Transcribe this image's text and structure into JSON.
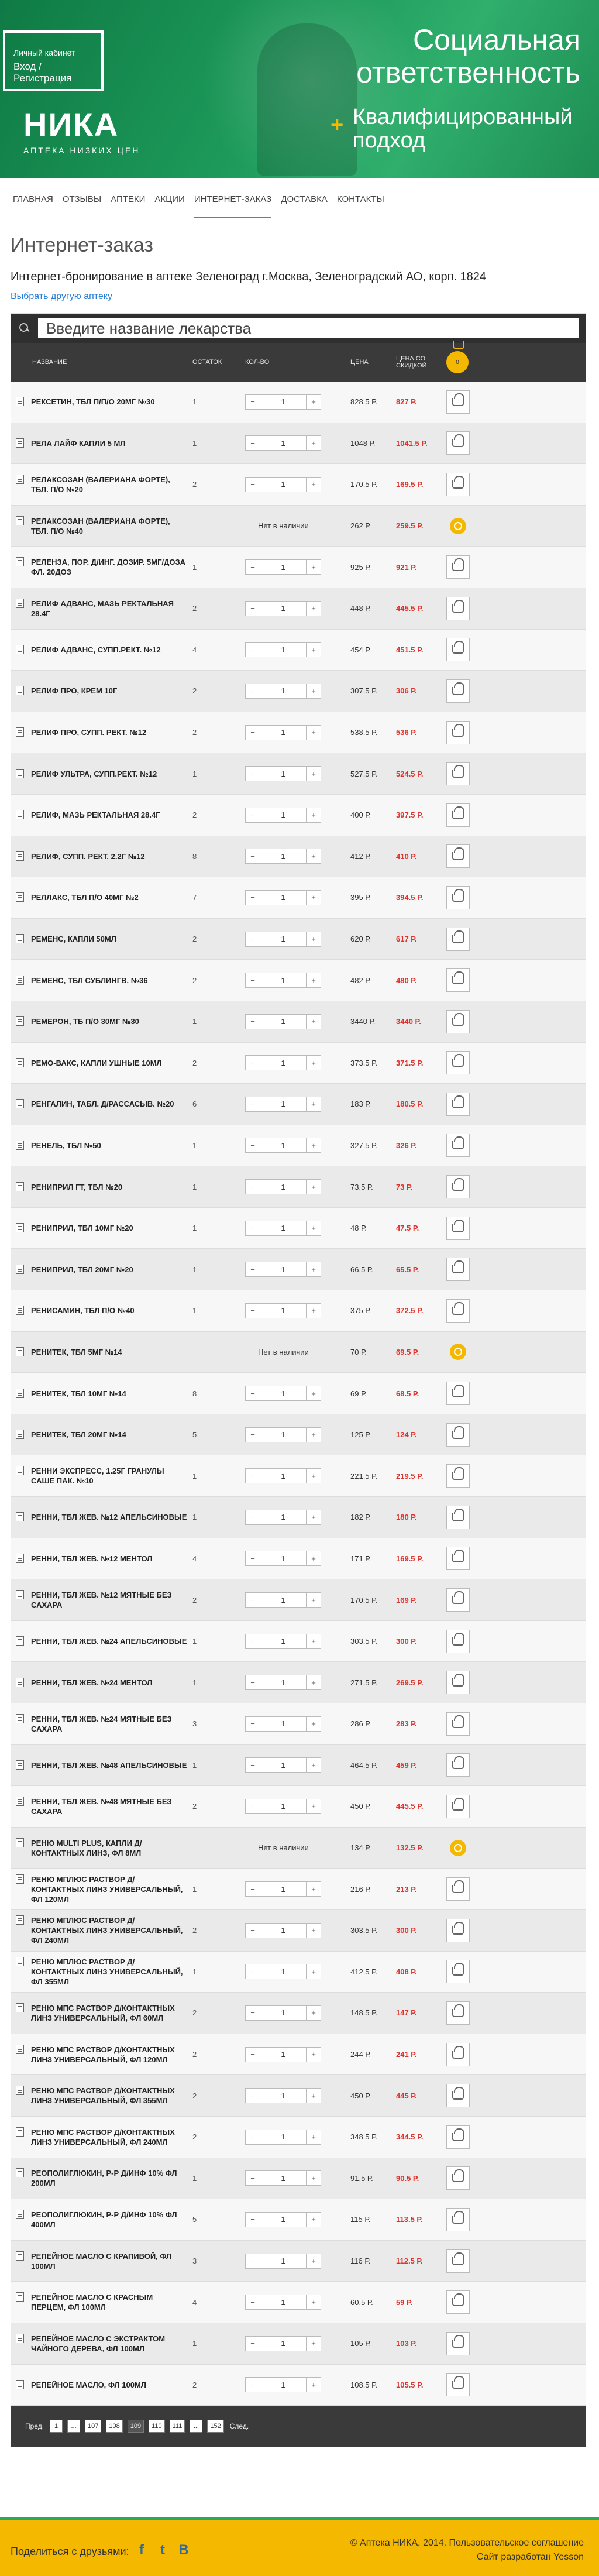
{
  "hero": {
    "lk_title": "Личный кабинет",
    "lk_link": "Вход / Регистрация",
    "logo_word": "НИКА",
    "logo_sub": "АПТЕКА НИЗКИХ ЦЕН",
    "headline_line1": "Социальная",
    "headline_line2": "ответственность",
    "sub_line1": "Квалифицированный",
    "sub_line2": "подход",
    "plus": "+"
  },
  "nav": {
    "items": [
      "ГЛАВНАЯ",
      "ОТЗЫВЫ",
      "АПТЕКИ",
      "АКЦИИ",
      "ИНТЕРНЕТ-ЗАКАЗ",
      "ДОСТАВКА",
      "КОНТАКТЫ"
    ],
    "active_index": 4
  },
  "page": {
    "title": "Интернет-заказ",
    "booking": "Интернет-бронирование в аптеке Зеленоград г.Москва, Зеленоградский АО, корп. 1824",
    "other_pharmacy": "Выбрать другую аптеку"
  },
  "search": {
    "placeholder": "Введите название лекарства"
  },
  "table_head": {
    "name": "НАЗВАНИЕ",
    "stock": "ОСТАТОК",
    "qty": "КОЛ-ВО",
    "price": "ЦЕНА",
    "discount": "ЦЕНА СО СКИДКОЙ",
    "cart_count": "0"
  },
  "qty_minus": "−",
  "qty_plus": "+",
  "not_available": "Нет в наличии",
  "rows": [
    {
      "name": "РЕКСЕТИН, ТБЛ П/П/О 20МГ №30",
      "stock": "1",
      "qty": "1",
      "price": "828.5 Р.",
      "disc": "827 Р.",
      "available": true
    },
    {
      "name": "РЕЛА ЛАЙФ КАПЛИ 5 МЛ",
      "stock": "1",
      "qty": "1",
      "price": "1048 Р.",
      "disc": "1041.5 Р.",
      "available": true
    },
    {
      "name": "РЕЛАКСОЗАН (ВАЛЕРИАНА ФОРТЕ), ТБЛ. П/О №20",
      "stock": "2",
      "qty": "1",
      "price": "170.5 Р.",
      "disc": "169.5 Р.",
      "available": true
    },
    {
      "name": "РЕЛАКСОЗАН (ВАЛЕРИАНА ФОРТЕ), ТБЛ. П/О №40",
      "stock": "",
      "qty": "",
      "price": "262 Р.",
      "disc": "259.5 Р.",
      "available": false
    },
    {
      "name": "РЕЛЕНЗА, ПОР. Д/ИНГ. ДОЗИР. 5МГ/ДОЗА ФЛ. 20ДОЗ",
      "stock": "1",
      "qty": "1",
      "price": "925 Р.",
      "disc": "921 Р.",
      "available": true
    },
    {
      "name": "РЕЛИФ АДВАНС, МАЗЬ РЕКТАЛЬНАЯ 28.4Г",
      "stock": "2",
      "qty": "1",
      "price": "448 Р.",
      "disc": "445.5 Р.",
      "available": true
    },
    {
      "name": "РЕЛИФ АДВАНС, СУПП.РЕКТ. №12",
      "stock": "4",
      "qty": "1",
      "price": "454 Р.",
      "disc": "451.5 Р.",
      "available": true
    },
    {
      "name": "РЕЛИФ ПРО, КРЕМ 10Г",
      "stock": "2",
      "qty": "1",
      "price": "307.5 Р.",
      "disc": "306 Р.",
      "available": true
    },
    {
      "name": "РЕЛИФ ПРО, СУПП. РЕКТ. №12",
      "stock": "2",
      "qty": "1",
      "price": "538.5 Р.",
      "disc": "536 Р.",
      "available": true
    },
    {
      "name": "РЕЛИФ УЛЬТРА, СУПП.РЕКТ. №12",
      "stock": "1",
      "qty": "1",
      "price": "527.5 Р.",
      "disc": "524.5 Р.",
      "available": true
    },
    {
      "name": "РЕЛИФ, МАЗЬ РЕКТАЛЬНАЯ 28.4Г",
      "stock": "2",
      "qty": "1",
      "price": "400 Р.",
      "disc": "397.5 Р.",
      "available": true
    },
    {
      "name": "РЕЛИФ, СУПП. РЕКТ. 2.2Г №12",
      "stock": "8",
      "qty": "1",
      "price": "412 Р.",
      "disc": "410 Р.",
      "available": true
    },
    {
      "name": "РЕЛЛАКС, ТБЛ П/О 40МГ №2",
      "stock": "7",
      "qty": "1",
      "price": "395 Р.",
      "disc": "394.5 Р.",
      "available": true
    },
    {
      "name": "РЕМЕНС, КАПЛИ 50МЛ",
      "stock": "2",
      "qty": "1",
      "price": "620 Р.",
      "disc": "617 Р.",
      "available": true
    },
    {
      "name": "РЕМЕНС, ТБЛ СУБЛИНГВ. №36",
      "stock": "2",
      "qty": "1",
      "price": "482 Р.",
      "disc": "480 Р.",
      "available": true
    },
    {
      "name": "РЕМЕРОН, ТБ П/О 30МГ №30",
      "stock": "1",
      "qty": "1",
      "price": "3440 Р.",
      "disc": "3440 Р.",
      "available": true
    },
    {
      "name": "РЕМО-ВАКС, КАПЛИ УШНЫЕ 10МЛ",
      "stock": "2",
      "qty": "1",
      "price": "373.5 Р.",
      "disc": "371.5 Р.",
      "available": true
    },
    {
      "name": "РЕНГАЛИН, ТАБЛ. Д/РАССАСЫВ. №20",
      "stock": "6",
      "qty": "1",
      "price": "183 Р.",
      "disc": "180.5 Р.",
      "available": true
    },
    {
      "name": "РЕНЕЛЬ, ТБЛ №50",
      "stock": "1",
      "qty": "1",
      "price": "327.5 Р.",
      "disc": "326 Р.",
      "available": true
    },
    {
      "name": "РЕНИПРИЛ ГТ, ТБЛ №20",
      "stock": "1",
      "qty": "1",
      "price": "73.5 Р.",
      "disc": "73 Р.",
      "available": true
    },
    {
      "name": "РЕНИПРИЛ, ТБЛ 10МГ №20",
      "stock": "1",
      "qty": "1",
      "price": "48 Р.",
      "disc": "47.5 Р.",
      "available": true
    },
    {
      "name": "РЕНИПРИЛ, ТБЛ 20МГ №20",
      "stock": "1",
      "qty": "1",
      "price": "66.5 Р.",
      "disc": "65.5 Р.",
      "available": true
    },
    {
      "name": "РЕНИСАМИН, ТБЛ П/О №40",
      "stock": "1",
      "qty": "1",
      "price": "375 Р.",
      "disc": "372.5 Р.",
      "available": true
    },
    {
      "name": "РЕНИТЕК, ТБЛ 5МГ №14",
      "stock": "",
      "qty": "",
      "price": "70 Р.",
      "disc": "69.5 Р.",
      "available": false
    },
    {
      "name": "РЕНИТЕК, ТБЛ 10МГ №14",
      "stock": "8",
      "qty": "1",
      "price": "69 Р.",
      "disc": "68.5 Р.",
      "available": true
    },
    {
      "name": "РЕНИТЕК, ТБЛ 20МГ №14",
      "stock": "5",
      "qty": "1",
      "price": "125 Р.",
      "disc": "124 Р.",
      "available": true
    },
    {
      "name": "РЕННИ ЭКСПРЕСС, 1.25Г ГРАНУЛЫ САШЕ ПАК. №10",
      "stock": "1",
      "qty": "1",
      "price": "221.5 Р.",
      "disc": "219.5 Р.",
      "available": true
    },
    {
      "name": "РЕННИ, ТБЛ ЖЕВ. №12 АПЕЛЬСИНОВЫЕ",
      "stock": "1",
      "qty": "1",
      "price": "182 Р.",
      "disc": "180 Р.",
      "available": true
    },
    {
      "name": "РЕННИ, ТБЛ ЖЕВ. №12 МЕНТОЛ",
      "stock": "4",
      "qty": "1",
      "price": "171 Р.",
      "disc": "169.5 Р.",
      "available": true
    },
    {
      "name": "РЕННИ, ТБЛ ЖЕВ. №12 МЯТНЫЕ БЕЗ САХАРА",
      "stock": "2",
      "qty": "1",
      "price": "170.5 Р.",
      "disc": "169 Р.",
      "available": true
    },
    {
      "name": "РЕННИ, ТБЛ ЖЕВ. №24 АПЕЛЬСИНОВЫЕ",
      "stock": "1",
      "qty": "1",
      "price": "303.5 Р.",
      "disc": "300 Р.",
      "available": true
    },
    {
      "name": "РЕННИ, ТБЛ ЖЕВ. №24 МЕНТОЛ",
      "stock": "1",
      "qty": "1",
      "price": "271.5 Р.",
      "disc": "269.5 Р.",
      "available": true
    },
    {
      "name": "РЕННИ, ТБЛ ЖЕВ. №24 МЯТНЫЕ БЕЗ САХАРА",
      "stock": "3",
      "qty": "1",
      "price": "286 Р.",
      "disc": "283 Р.",
      "available": true
    },
    {
      "name": "РЕННИ, ТБЛ ЖЕВ. №48 АПЕЛЬСИНОВЫЕ",
      "stock": "1",
      "qty": "1",
      "price": "464.5 Р.",
      "disc": "459 Р.",
      "available": true
    },
    {
      "name": "РЕННИ, ТБЛ ЖЕВ. №48 МЯТНЫЕ БЕЗ САХАРА",
      "stock": "2",
      "qty": "1",
      "price": "450 Р.",
      "disc": "445.5 Р.",
      "available": true
    },
    {
      "name": "РЕНЮ MULTI PLUS, КАПЛИ Д/КОНТАКТНЫХ ЛИНЗ, ФЛ 8МЛ",
      "stock": "",
      "qty": "",
      "price": "134 Р.",
      "disc": "132.5 Р.",
      "available": false
    },
    {
      "name": "РЕНЮ МПЛЮС РАСТВОР Д/КОНТАКТНЫХ ЛИНЗ УНИВЕРСАЛЬНЫЙ, ФЛ 120МЛ",
      "stock": "1",
      "qty": "1",
      "price": "216 Р.",
      "disc": "213 Р.",
      "available": true
    },
    {
      "name": "РЕНЮ МПЛЮС РАСТВОР Д/КОНТАКТНЫХ ЛИНЗ УНИВЕРСАЛЬНЫЙ, ФЛ 240МЛ",
      "stock": "2",
      "qty": "1",
      "price": "303.5 Р.",
      "disc": "300 Р.",
      "available": true
    },
    {
      "name": "РЕНЮ МПЛЮС РАСТВОР Д/КОНТАКТНЫХ ЛИНЗ УНИВЕРСАЛЬНЫЙ, ФЛ 355МЛ",
      "stock": "1",
      "qty": "1",
      "price": "412.5 Р.",
      "disc": "408 Р.",
      "available": true
    },
    {
      "name": "РЕНЮ МПС РАСТВОР Д/КОНТАКТНЫХ ЛИНЗ УНИВЕРСАЛЬНЫЙ, ФЛ 60МЛ",
      "stock": "2",
      "qty": "1",
      "price": "148.5 Р.",
      "disc": "147 Р.",
      "available": true
    },
    {
      "name": "РЕНЮ МПС РАСТВОР Д/КОНТАКТНЫХ ЛИНЗ УНИВЕРСАЛЬНЫЙ, ФЛ 120МЛ",
      "stock": "2",
      "qty": "1",
      "price": "244 Р.",
      "disc": "241 Р.",
      "available": true
    },
    {
      "name": "РЕНЮ МПС РАСТВОР Д/КОНТАКТНЫХ ЛИНЗ УНИВЕРСАЛЬНЫЙ, ФЛ 355МЛ",
      "stock": "2",
      "qty": "1",
      "price": "450 Р.",
      "disc": "445 Р.",
      "available": true
    },
    {
      "name": "РЕНЮ МПС РАСТВОР Д/КОНТАКТНЫХ ЛИНЗ УНИВЕРСАЛЬНЫЙ, ФЛ 240МЛ",
      "stock": "2",
      "qty": "1",
      "price": "348.5 Р.",
      "disc": "344.5 Р.",
      "available": true
    },
    {
      "name": "РЕОПОЛИГЛЮКИН, Р-Р Д/ИНФ 10% ФЛ 200МЛ",
      "stock": "1",
      "qty": "1",
      "price": "91.5 Р.",
      "disc": "90.5 Р.",
      "available": true
    },
    {
      "name": "РЕОПОЛИГЛЮКИН, Р-Р Д/ИНФ 10% ФЛ 400МЛ",
      "stock": "5",
      "qty": "1",
      "price": "115 Р.",
      "disc": "113.5 Р.",
      "available": true
    },
    {
      "name": "РЕПЕЙНОЕ МАСЛО С КРАПИВОЙ, ФЛ 100МЛ",
      "stock": "3",
      "qty": "1",
      "price": "116 Р.",
      "disc": "112.5 Р.",
      "available": true
    },
    {
      "name": "РЕПЕЙНОЕ МАСЛО С КРАСНЫМ ПЕРЦЕМ, ФЛ 100МЛ",
      "stock": "4",
      "qty": "1",
      "price": "60.5 Р.",
      "disc": "59 Р.",
      "available": true
    },
    {
      "name": "РЕПЕЙНОЕ МАСЛО С ЭКСТРАКТОМ ЧАЙНОГО ДЕРЕВА, ФЛ 100МЛ",
      "stock": "1",
      "qty": "1",
      "price": "105 Р.",
      "disc": "103 Р.",
      "available": true
    },
    {
      "name": "РЕПЕЙНОЕ МАСЛО, ФЛ 100МЛ",
      "stock": "2",
      "qty": "1",
      "price": "108.5 Р.",
      "disc": "105.5 Р.",
      "available": true
    }
  ],
  "pager": {
    "prev": "Пред.",
    "next": "След.",
    "pages": [
      "1",
      "...",
      "107",
      "108",
      "109",
      "110",
      "111",
      "...",
      "152"
    ],
    "current": "109"
  },
  "footer": {
    "share": "Поделиться с друзьями:",
    "socials": [
      "f",
      "t",
      "В"
    ],
    "copyright": "© Аптека НИКА, 2014. Пользовательское соглашение",
    "credits": "Сайт разработан Yesson"
  }
}
